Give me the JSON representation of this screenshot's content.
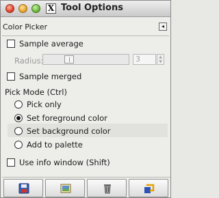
{
  "window": {
    "title": "Tool Options"
  },
  "tab": {
    "title": "Color Picker",
    "menu_glyph": "◂"
  },
  "options": {
    "sample_average": "Sample average",
    "radius_label": "Radius:",
    "radius_value": "3",
    "sample_merged": "Sample merged",
    "pick_mode_label": "Pick Mode  (Ctrl)",
    "modes": [
      {
        "label": "Pick only",
        "selected": false
      },
      {
        "label": "Set foreground color",
        "selected": true
      },
      {
        "label": "Set background color",
        "selected": false
      },
      {
        "label": "Add to palette",
        "selected": false
      }
    ],
    "use_info_window": "Use info window  (Shift)"
  },
  "toolbar": {
    "buttons": [
      "save-options-icon",
      "restore-options-icon",
      "delete-options-icon",
      "reset-options-icon"
    ]
  },
  "colors": {
    "window_bg": "#ededea",
    "accent_orange": "#e6a100"
  }
}
